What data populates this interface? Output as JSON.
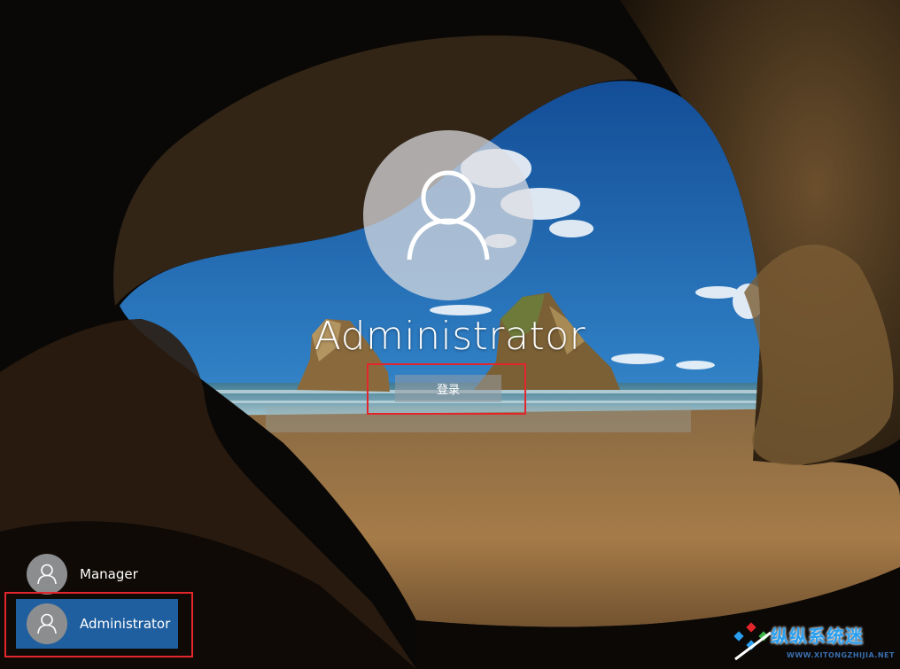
{
  "current_user": {
    "name": "Administrator",
    "avatar_icon": "user-icon",
    "signin_label": "登录"
  },
  "user_list": [
    {
      "name": "Manager",
      "avatar_icon": "user-icon",
      "selected": false
    },
    {
      "name": "Administrator",
      "avatar_icon": "user-icon",
      "selected": true
    }
  ],
  "watermark": {
    "text": "纵纵系统迷",
    "subtext": "WWW.XITONGZHIJIA.NET",
    "logo_icon": "brand-logo-icon"
  },
  "colors": {
    "selected_user_bg": "#1f5f9f",
    "highlight_red": "#e2262b",
    "watermark_blue": "#2a9ff0"
  }
}
